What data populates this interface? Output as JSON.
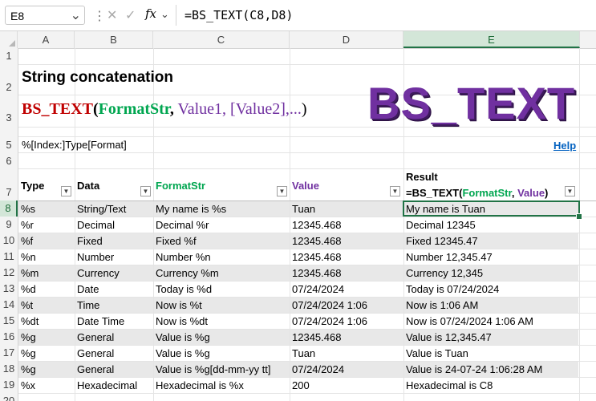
{
  "formula_bar": {
    "name_box": "E8",
    "formula": "=BS_TEXT(C8,D8)",
    "fx_label": "fx"
  },
  "columns": [
    "A",
    "B",
    "C",
    "D",
    "E"
  ],
  "selected_cell": {
    "column": "E",
    "row": 8
  },
  "rows": [
    "1",
    "2",
    "3",
    "4",
    "5",
    "6",
    "7",
    "8",
    "9",
    "10",
    "11",
    "12",
    "13",
    "14",
    "15",
    "16",
    "17",
    "18",
    "19",
    "20"
  ],
  "sheet": {
    "title": "String concatenation",
    "syntax": {
      "fn": "BS_TEXT",
      "open": "(",
      "format_arg": "FormatStr",
      "comma": ",",
      "values": " Value1, [Value2],...",
      "close": ")"
    },
    "banner": "BS_TEXT",
    "format_spec": "%[Index:]Type[Format]",
    "help_link": "Help"
  },
  "table": {
    "headers": {
      "type": "Type",
      "data": "Data",
      "format": "FormatStr",
      "value": "Value",
      "result_title": "Result",
      "result_formula_fn": "=BS_TEXT(",
      "result_formula_fmt": "FormatStr",
      "result_formula_comma": ", ",
      "result_formula_val": "Value",
      "result_formula_close": ")"
    },
    "header_colors": {
      "format": "#00a650",
      "value": "#7030a0"
    },
    "rows": [
      {
        "type": "%s",
        "data": "String/Text",
        "format": "My name is %s",
        "value": "Tuan",
        "result": "My name is Tuan"
      },
      {
        "type": "%r",
        "data": "Decimal",
        "format": "Decimal %r",
        "value": "12345.468",
        "result": "Decimal 12345"
      },
      {
        "type": "%f",
        "data": "Fixed",
        "format": "Fixed %f",
        "value": "12345.468",
        "result": "Fixed 12345.47"
      },
      {
        "type": "%n",
        "data": "Number",
        "format": "Number %n",
        "value": "12345.468",
        "result": "Number 12,345.47"
      },
      {
        "type": "%m",
        "data": "Currency",
        "format": "Currency %m",
        "value": "12345.468",
        "result": "Currency 12,345"
      },
      {
        "type": "%d",
        "data": "Date",
        "format": "Today is %d",
        "value": "07/24/2024",
        "result": "Today is 07/24/2024"
      },
      {
        "type": "%t",
        "data": "Time",
        "format": "Now is %t",
        "value": "07/24/2024 1:06",
        "result": "Now is 1:06 AM"
      },
      {
        "type": "%dt",
        "data": "Date Time",
        "format": "Now is %dt",
        "value": "07/24/2024 1:06",
        "result": "Now is 07/24/2024 1:06 AM"
      },
      {
        "type": "%g",
        "data": "General",
        "format": "Value is %g",
        "value": "12345.468",
        "result": "Value is 12,345.47"
      },
      {
        "type": "%g",
        "data": "General",
        "format": "Value is %g",
        "value": "Tuan",
        "result": "Value is Tuan"
      },
      {
        "type": "%g",
        "data": "General",
        "format": "Value is %g[dd-mm-yy tt]",
        "value": "07/24/2024",
        "result": "Value is 24-07-24 1:06:28 AM"
      },
      {
        "type": "%x",
        "data": "Hexadecimal",
        "format": "Hexadecimal is %x",
        "value": "200",
        "result": "Hexadecimal is C8"
      }
    ]
  },
  "colors": {
    "accent": "#217346",
    "function": "#c00000",
    "banner": "#7030a0",
    "link": "#0563c1"
  }
}
